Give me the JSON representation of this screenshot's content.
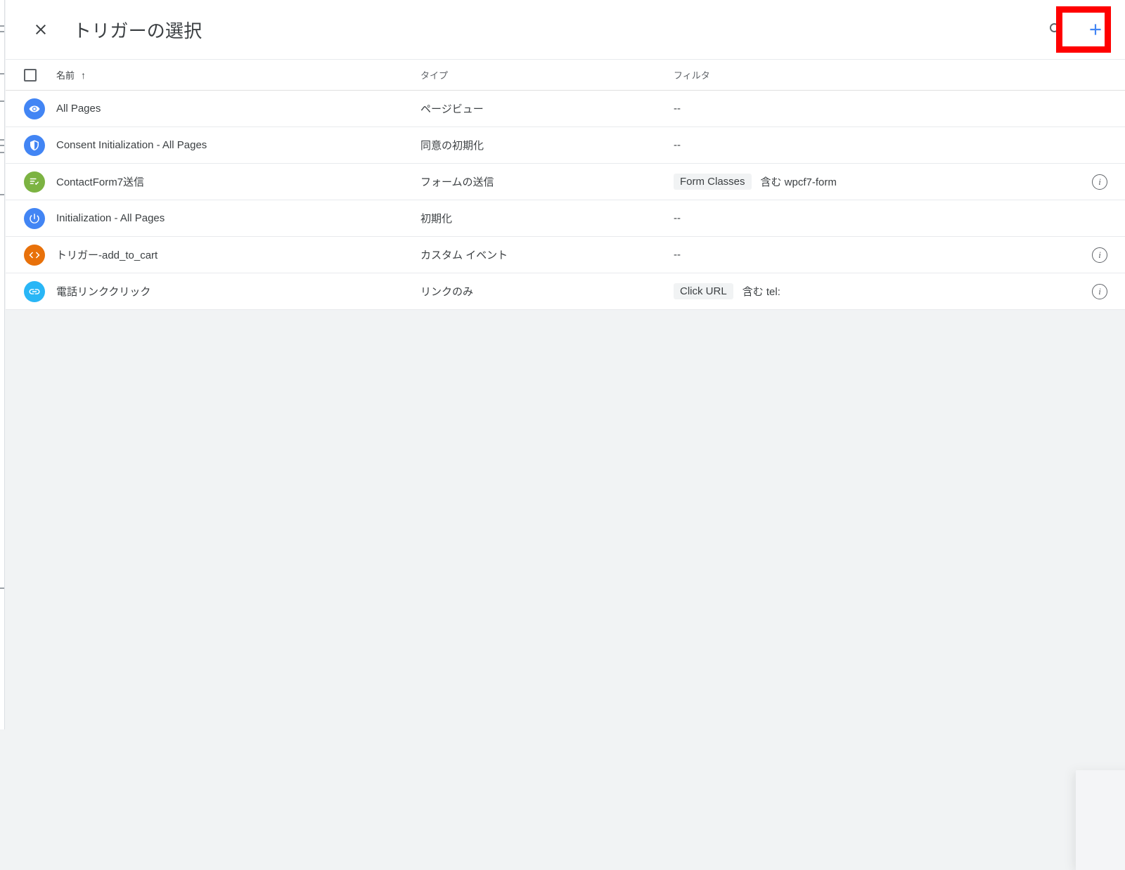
{
  "dialog": {
    "title": "トリガーの選択",
    "close_icon": "close-icon",
    "search_icon": "search-icon",
    "add_label": "+"
  },
  "table": {
    "headers": {
      "name": "名前",
      "sort_arrow": "↑",
      "type": "タイプ",
      "filter": "フィルタ"
    },
    "rows": [
      {
        "name": "All Pages",
        "type": "ページビュー",
        "filter_chip": "",
        "filter_text": "--",
        "icon": "pageview-icon",
        "icon_color": "#4285F4",
        "has_info": false
      },
      {
        "name": "Consent Initialization - All Pages",
        "type": "同意の初期化",
        "filter_chip": "",
        "filter_text": "--",
        "icon": "shield-consent-icon",
        "icon_color": "#4285F4",
        "has_info": false
      },
      {
        "name": "ContactForm7送信",
        "type": "フォームの送信",
        "filter_chip": "Form Classes",
        "filter_text": "含む wpcf7-form",
        "icon": "form-submit-icon",
        "icon_color": "#7CB342",
        "has_info": true
      },
      {
        "name": "Initialization - All Pages",
        "type": "初期化",
        "filter_chip": "",
        "filter_text": "--",
        "icon": "power-initialization-icon",
        "icon_color": "#4285F4",
        "has_info": false
      },
      {
        "name": "トリガー-add_to_cart",
        "type": "カスタム イベント",
        "filter_chip": "",
        "filter_text": "--",
        "icon": "custom-event-code-icon",
        "icon_color": "#E8710A",
        "has_info": true
      },
      {
        "name": "電話リンククリック",
        "type": "リンクのみ",
        "filter_chip": "Click URL",
        "filter_text": "含む tel:",
        "icon": "link-click-icon",
        "icon_color": "#29B6F6",
        "has_info": true
      }
    ]
  },
  "annotation": {
    "highlight_color": "#ff0000",
    "target": "add-trigger-button"
  },
  "colors": {
    "accent_blue": "#4285F4",
    "page_bg": "#f1f3f4",
    "surface": "#ffffff",
    "divider": "#e8eaed",
    "text_primary": "#3c4043",
    "text_secondary": "#5f6368"
  }
}
